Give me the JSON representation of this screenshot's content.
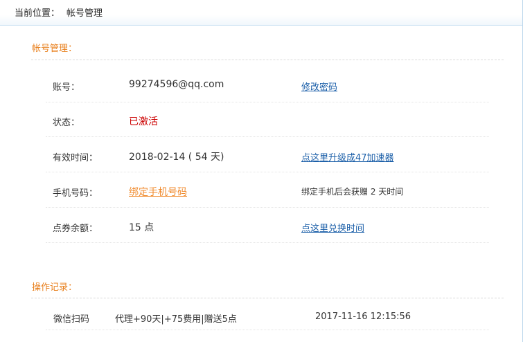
{
  "breadcrumb": {
    "prefix": "当前位置：",
    "current": "帐号管理"
  },
  "account_section": {
    "title": "帐号管理："
  },
  "account_rows": {
    "account": {
      "label": "账号：",
      "value": "99274596@qq.com",
      "action": "修改密码"
    },
    "status": {
      "label": "状态：",
      "value": "已激活"
    },
    "validity": {
      "label": "有效时间：",
      "value": "2018-02-14 ( 54 天)",
      "action": "点这里升级成47加速器"
    },
    "phone": {
      "label": "手机号码：",
      "value": "绑定手机号码",
      "note": "绑定手机后会获赠 2 天时间"
    },
    "points": {
      "label": "点券余额：",
      "value": "15 点",
      "action": "点这里兑换时间"
    }
  },
  "records_section": {
    "title": "操作记录："
  },
  "records": [
    {
      "type": "微信扫码",
      "detail": "代理+90天|+75费用|赠送5点",
      "time": "2017-11-16 12:15:56"
    }
  ],
  "colors": {
    "section_title": "#e87f1c",
    "status_active": "#cc0000",
    "link_blue": "#1a5ea8",
    "link_orange": "#f08a2c"
  }
}
